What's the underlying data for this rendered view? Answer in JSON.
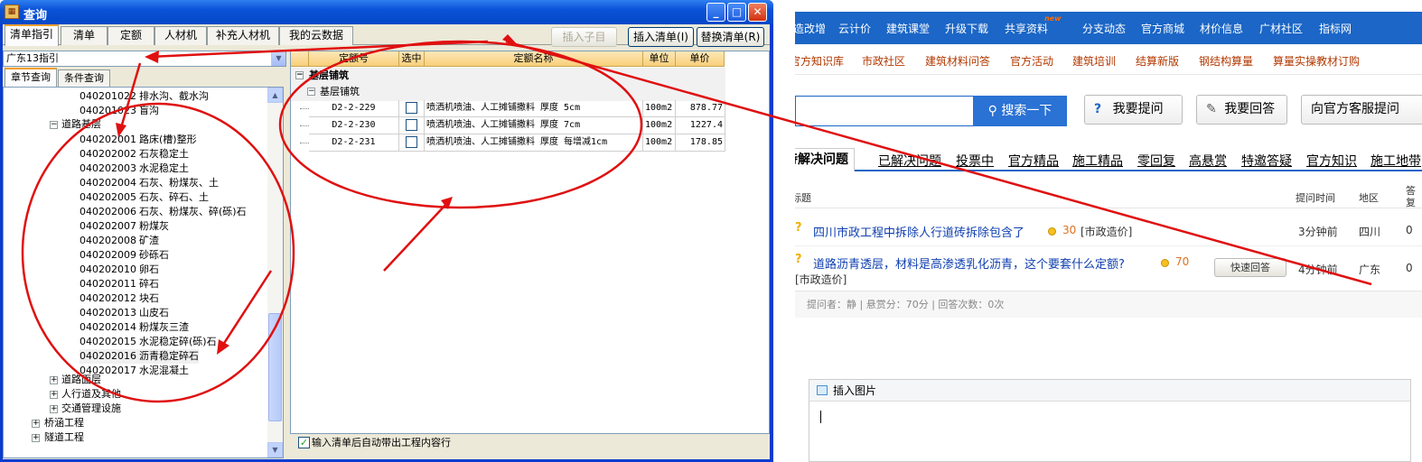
{
  "window": {
    "title": "查询",
    "min": "_",
    "max": "□",
    "close": "✕"
  },
  "tabs": [
    "清单指引",
    "清单",
    "定额",
    "人材机",
    "补充人材机",
    "我的云数据"
  ],
  "buttons": {
    "insert_child": "插入子目",
    "insert_list": "插入清单(I)",
    "replace_list": "替换清单(R)"
  },
  "combo": {
    "value": "广东13指引"
  },
  "subtabs": [
    "章节查询",
    "条件查询"
  ],
  "tree": {
    "top": [
      {
        "code": "040201022",
        "name": "排水沟、截水沟"
      },
      {
        "code": "040201023",
        "name": "盲沟"
      }
    ],
    "group": "道路基层",
    "items": [
      {
        "code": "040202001",
        "name": "路床(槽)整形"
      },
      {
        "code": "040202002",
        "name": "石灰稳定土"
      },
      {
        "code": "040202003",
        "name": "水泥稳定土"
      },
      {
        "code": "040202004",
        "name": "石灰、粉煤灰、土"
      },
      {
        "code": "040202005",
        "name": "石灰、碎石、土"
      },
      {
        "code": "040202006",
        "name": "石灰、粉煤灰、碎(砾)石"
      },
      {
        "code": "040202007",
        "name": "粉煤灰"
      },
      {
        "code": "040202008",
        "name": "矿渣"
      },
      {
        "code": "040202009",
        "name": "砂砾石"
      },
      {
        "code": "040202010",
        "name": "卵石"
      },
      {
        "code": "040202011",
        "name": "碎石"
      },
      {
        "code": "040202012",
        "name": "块石"
      },
      {
        "code": "040202013",
        "name": "山皮石"
      },
      {
        "code": "040202014",
        "name": "粉煤灰三渣"
      },
      {
        "code": "040202015",
        "name": "水泥稳定碎(砾)石"
      },
      {
        "code": "040202016",
        "name": "沥青稳定碎石"
      },
      {
        "code": "040202017",
        "name": "水泥混凝土"
      }
    ],
    "siblings": [
      "道路面层",
      "人行道及其他",
      "交通管理设施"
    ],
    "roots": [
      "桥涵工程",
      "隧道工程"
    ]
  },
  "grid": {
    "headers": [
      "定额号",
      "选中",
      "定额名称",
      "单位",
      "单价"
    ],
    "group1": "基层铺筑",
    "group2": "基层铺筑",
    "rows": [
      {
        "code": "D2-2-229",
        "name": "喷洒机喷油、人工摊铺撒料 厚度 5cm",
        "unit": "100m2",
        "price": "878.77"
      },
      {
        "code": "D2-2-230",
        "name": "喷洒机喷油、人工摊铺撒料 厚度 7cm",
        "unit": "100m2",
        "price": "1227.4"
      },
      {
        "code": "D2-2-231",
        "name": "喷洒机喷油、人工摊铺撒料 厚度 每增减1cm",
        "unit": "100m2",
        "price": "178.85"
      }
    ]
  },
  "bottom_check": "输入清单后自动带出工程内容行",
  "web": {
    "nav1": [
      "造改增",
      "云计价",
      "建筑课堂",
      "升级下载",
      "共享资料",
      "分支动态",
      "官方商城",
      "材价信息",
      "广材社区",
      "指标网"
    ],
    "new_tag": "new",
    "nav2": [
      "官方知识库",
      "市政社区",
      "建筑材料问答",
      "官方活动",
      "建筑培训",
      "结算新版",
      "钢结构算量",
      "算量实操教材订购"
    ],
    "search_btn": "搜索一下",
    "ask_btn": "我要提问",
    "answer_btn": "我要回答",
    "service_btn": "向官方客服提问",
    "qtabs": [
      "待解决问题",
      "已解决问题",
      "投票中",
      "官方精品",
      "施工精品",
      "零回复",
      "高悬赏",
      "特邀答疑",
      "官方知识",
      "施工地带"
    ],
    "headers": {
      "title": "标题",
      "time": "提问时间",
      "region": "地区",
      "reply": "答复"
    },
    "q1": {
      "title": "四川市政工程中拆除人行道砖拆除包含了",
      "points": "30",
      "tag": "[市政造价]",
      "time": "3分钟前",
      "region": "四川",
      "replies": "0"
    },
    "q2": {
      "title": "道路沥青透层，材料是高渗透乳化沥青，这个要套什么定额?",
      "points": "70",
      "tag": "[市政造价]",
      "quick": "快速回答",
      "time": "4分钟前",
      "region": "广东",
      "replies": "0"
    },
    "meta": "提问者：静  |  悬赏分：70分  |  回答次数：0次",
    "insert_image": "插入图片"
  },
  "colors": {
    "annotation": "#e01010",
    "xp_blue": "#0a52d8",
    "web_blue": "#1b66c6"
  }
}
